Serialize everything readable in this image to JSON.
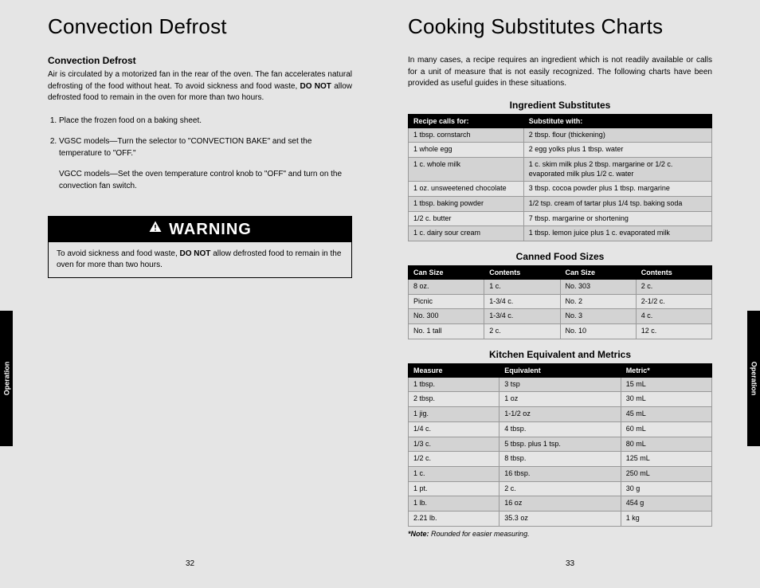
{
  "left": {
    "title": "Convection Defrost",
    "subheading": "Convection Defrost",
    "intro_a": "Air is circulated by a motorized fan in the rear of the oven. The fan accelerates natural defrosting of the food without heat. To avoid sickness and food waste, ",
    "intro_b": "DO NOT",
    "intro_c": " allow defrosted food to remain in the oven for more than two hours.",
    "step1": "Place the frozen food on a baking sheet.",
    "step2a": "VGSC models—Turn the selector to \"CONVECTION BAKE\" and set the temperature to \"OFF.\"",
    "step2b": "VGCC models—Set the oven temperature control knob to \"OFF\" and turn on the convection fan switch.",
    "warning_label": "WARNING",
    "warning_a": "To avoid sickness and food waste, ",
    "warning_b": "DO NOT",
    "warning_c": " allow defrosted food to remain in the oven for more than two hours.",
    "sidetab": "Operation",
    "pgnum": "32"
  },
  "right": {
    "title": "Cooking Substitutes Charts",
    "intro": "In many cases, a recipe requires an ingredient which is not readily available or calls for a unit of measure that is not easily recognized. The following charts have been provided as useful guides in these situations.",
    "sidetab": "Operation",
    "pgnum": "33",
    "note_label": "*Note:",
    "note_text": " Rounded for easier measuring.",
    "t1": {
      "title": "Ingredient Substitutes",
      "h1": "Recipe calls for:",
      "h2": "Substitute with:",
      "rows": [
        {
          "a": "1 tbsp. cornstarch",
          "b": "2 tbsp. flour (thickening)"
        },
        {
          "a": "1 whole egg",
          "b": "2 egg yolks plus 1 tbsp. water"
        },
        {
          "a": "1 c. whole milk",
          "b": "1 c. skim milk plus 2 tbsp. margarine or 1/2 c. evaporated milk plus 1/2 c. water"
        },
        {
          "a": "1 oz. unsweetened chocolate",
          "b": "3 tbsp. cocoa powder plus 1 tbsp. margarine"
        },
        {
          "a": "1 tbsp. baking powder",
          "b": "1/2 tsp. cream of tartar plus 1/4 tsp. baking soda"
        },
        {
          "a": "1/2 c. butter",
          "b": "7 tbsp. margarine or shortening"
        },
        {
          "a": "1 c. dairy sour cream",
          "b": "1 tbsp. lemon juice plus 1 c. evaporated milk"
        }
      ]
    },
    "t2": {
      "title": "Canned Food Sizes",
      "h1": "Can Size",
      "h2": "Contents",
      "h3": "Can Size",
      "h4": "Contents",
      "rows": [
        {
          "a": "8 oz.",
          "b": "1 c.",
          "c": "No. 303",
          "d": "2 c."
        },
        {
          "a": "Picnic",
          "b": "1-3/4 c.",
          "c": "No. 2",
          "d": "2-1/2 c."
        },
        {
          "a": "No. 300",
          "b": "1-3/4 c.",
          "c": "No. 3",
          "d": "4 c."
        },
        {
          "a": "No. 1 tall",
          "b": "2 c.",
          "c": "No. 10",
          "d": "12 c."
        }
      ]
    },
    "t3": {
      "title": "Kitchen Equivalent and Metrics",
      "h1": "Measure",
      "h2": "Equivalent",
      "h3": "Metric*",
      "rows": [
        {
          "a": "1 tbsp.",
          "b": "3 tsp",
          "c": "15 mL"
        },
        {
          "a": "2 tbsp.",
          "b": "1 oz",
          "c": "30 mL"
        },
        {
          "a": "1 jig.",
          "b": "1-1/2 oz",
          "c": "45 mL"
        },
        {
          "a": "1/4 c.",
          "b": "4 tbsp.",
          "c": "60 mL"
        },
        {
          "a": "1/3 c.",
          "b": "5 tbsp. plus 1 tsp.",
          "c": "80 mL"
        },
        {
          "a": "1/2 c.",
          "b": "8 tbsp.",
          "c": "125 mL"
        },
        {
          "a": "1 c.",
          "b": "16 tbsp.",
          "c": "250 mL"
        },
        {
          "a": "1 pt.",
          "b": "2 c.",
          "c": "30 g"
        },
        {
          "a": "1 lb.",
          "b": "16 oz",
          "c": "454 g"
        },
        {
          "a": "2.21 lb.",
          "b": "35.3 oz",
          "c": "1 kg"
        }
      ]
    }
  }
}
